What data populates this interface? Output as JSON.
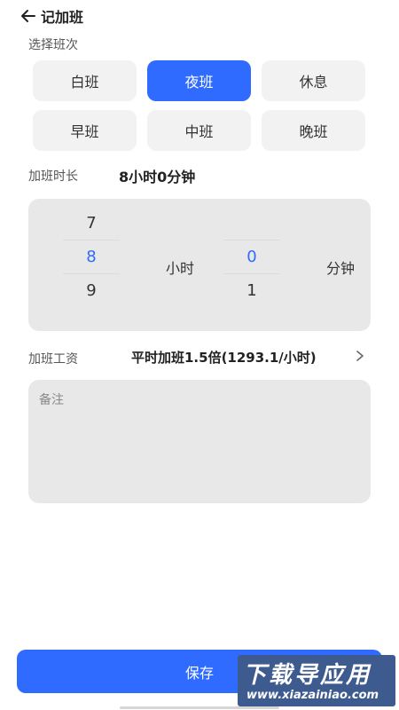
{
  "header": {
    "back_icon": "arrow-left-icon",
    "title": "记加班"
  },
  "shift": {
    "label": "选择班次",
    "options": [
      "白班",
      "夜班",
      "休息",
      "早班",
      "中班",
      "晚班"
    ],
    "selected": "夜班"
  },
  "duration": {
    "label": "加班时长",
    "value": "8小时0分钟",
    "hours": {
      "above": "7",
      "selected": "8",
      "below": "9",
      "unit": "小时"
    },
    "minutes": {
      "above": "",
      "selected": "0",
      "below": "1",
      "unit": "分钟"
    }
  },
  "wage": {
    "label": "加班工资",
    "value": "平时加班1.5倍(1293.1/小时)",
    "chevron_icon": "chevron-right-icon"
  },
  "remark": {
    "placeholder": "备注",
    "value": ""
  },
  "save_label": "保存",
  "watermark": {
    "main": "下载导应用",
    "sub": "www.xiazainiao.com"
  },
  "colors": {
    "accent": "#2f6bff",
    "panel": "#e8e8e8",
    "button_bg": "#f2f2f2"
  }
}
